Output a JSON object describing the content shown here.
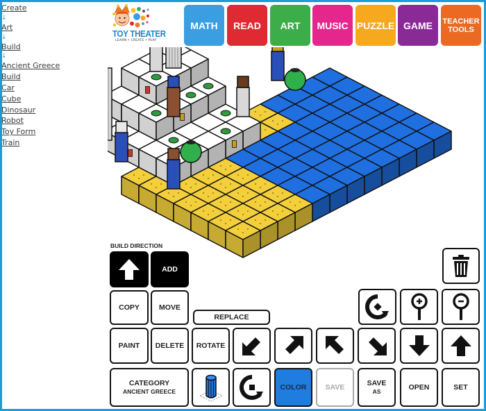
{
  "sidebar": {
    "breadcrumb": [
      {
        "label": "Create"
      },
      {
        "label": "Art"
      },
      {
        "label": "Build"
      },
      {
        "label": "Ancient Greece"
      }
    ],
    "separator": "↓",
    "links": [
      "Build",
      "Car",
      "Cube",
      "Dinosaur",
      "Robot",
      "Toy Form",
      "Train"
    ]
  },
  "logo": {
    "title": "TOY THEATER",
    "tagline": "LEARN • CREATE • PLAY"
  },
  "nav": [
    {
      "label": "MATH",
      "color": "#3a9ee0"
    },
    {
      "label": "READ",
      "color": "#e02a33"
    },
    {
      "label": "ART",
      "color": "#3cad48"
    },
    {
      "label": "MUSIC",
      "color": "#e5268c"
    },
    {
      "label": "PUZZLE",
      "color": "#f6a81e"
    },
    {
      "label": "GAME",
      "color": "#8a2a97"
    },
    {
      "label": "TEACHER TOOLS",
      "color": "#ea6a23"
    }
  ],
  "controls": {
    "build_direction_label": "BUILD DIRECTION",
    "add": "ADD",
    "copy": "COPY",
    "move": "MOVE",
    "replace": "REPLACE",
    "paint": "PAINT",
    "delete": "DELETE",
    "rotate": "ROTATE",
    "category_title": "CATEGORY",
    "category_value": "ANCIENT GREECE",
    "color": "COLOR",
    "save": "SAVE",
    "save_as_line1": "SAVE",
    "save_as_line2": "AS",
    "open": "OPEN",
    "set": "SET",
    "icons": {
      "build_direction": "arrow-up-icon",
      "trash": "trash-icon",
      "rotate_view": "rotate-view-icon",
      "zoom_in": "zoom-in-icon",
      "zoom_out": "zoom-out-icon",
      "move_sw": "arrow-down-left-icon",
      "move_ne": "arrow-up-right-icon",
      "move_nw": "arrow-up-left-icon",
      "move_se": "arrow-down-right-icon",
      "move_down": "arrow-down-icon",
      "move_up": "arrow-up-icon",
      "selected_piece": "column-piece-icon",
      "rotate_piece": "rotate-piece-icon"
    }
  },
  "colors": {
    "frame": "#1b9bd7",
    "sand": "#f3cf3c",
    "water": "#1f6fe0",
    "block": "#ffffff",
    "color_button": "#1f7de0"
  }
}
